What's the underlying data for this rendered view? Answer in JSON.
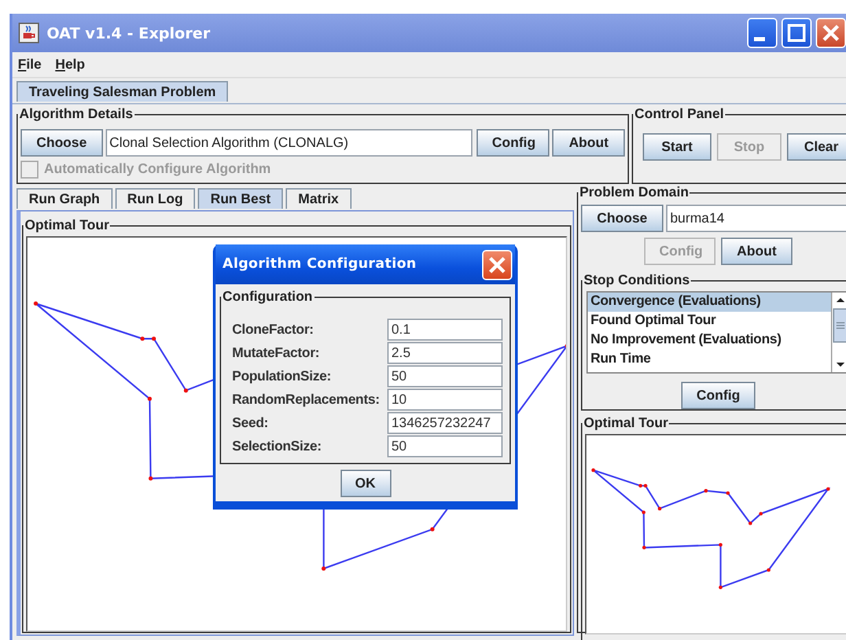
{
  "window": {
    "title": "OAT v1.4 - Explorer"
  },
  "menu": [
    {
      "label": "File"
    },
    {
      "label": "Help"
    }
  ],
  "problem_tabs": [
    {
      "label": "Traveling Salesman Problem",
      "selected": true
    }
  ],
  "algorithm_details": {
    "title": "Algorithm Details",
    "choose_button": "Choose",
    "algorithm_name": "Clonal Selection Algorithm (CLONALG)",
    "config_button": "Config",
    "about_button": "About",
    "auto_configure": {
      "label": "Automatically Configure Algorithm",
      "checked": false,
      "disabled": true
    }
  },
  "control_panel": {
    "title": "Control Panel",
    "buttons": [
      {
        "label": "Start",
        "disabled": false
      },
      {
        "label": "Stop",
        "disabled": true
      },
      {
        "label": "Clear",
        "disabled": false
      }
    ]
  },
  "view_tabs": [
    {
      "label": "Run Graph",
      "selected": false
    },
    {
      "label": "Run Log",
      "selected": false
    },
    {
      "label": "Run Best",
      "selected": true
    },
    {
      "label": "Matrix",
      "selected": false
    }
  ],
  "optimal_tour": {
    "title": "Optimal Tour"
  },
  "problem_domain": {
    "title": "Problem Domain",
    "choose_button": "Choose",
    "problem_name": "burma14",
    "buttons": [
      {
        "label": "Config",
        "disabled": true
      },
      {
        "label": "About",
        "disabled": false
      }
    ]
  },
  "stop_conditions": {
    "title": "Stop Conditions",
    "items": [
      {
        "label": "Convergence (Evaluations)",
        "selected": true
      },
      {
        "label": "Found Optimal Tour",
        "selected": false
      },
      {
        "label": "No Improvement (Evaluations)",
        "selected": false
      },
      {
        "label": "Run Time",
        "selected": false
      }
    ],
    "config_button": "Config"
  },
  "mini_tour": {
    "title": "Optimal Tour"
  },
  "dialog": {
    "title": "Algorithm Configuration",
    "group_title": "Configuration",
    "fields": [
      {
        "label": "CloneFactor:",
        "value": "0.1"
      },
      {
        "label": "MutateFactor:",
        "value": "2.5"
      },
      {
        "label": "PopulationSize:",
        "value": "50"
      },
      {
        "label": "RandomReplacements:",
        "value": "10"
      },
      {
        "label": "Seed:",
        "value": "1346257232247"
      },
      {
        "label": "SelectionSize:",
        "value": "50"
      }
    ],
    "ok_button": "OK"
  }
}
